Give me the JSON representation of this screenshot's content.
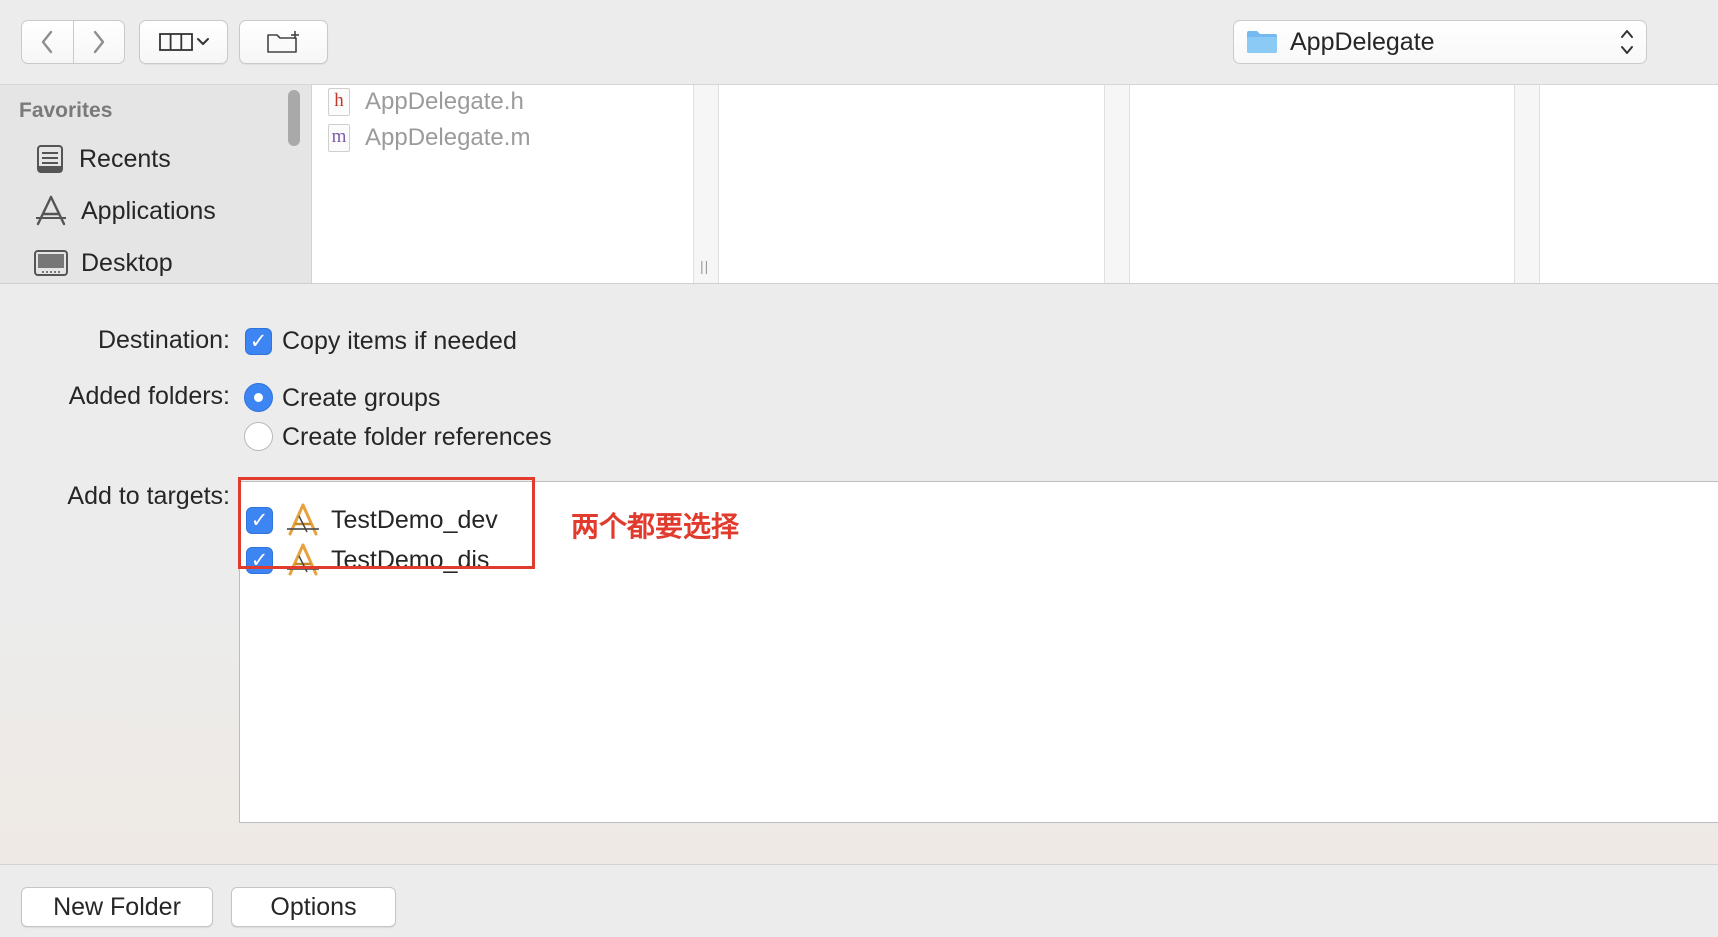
{
  "toolbar": {
    "location": "AppDelegate"
  },
  "sidebar": {
    "section_title": "Favorites",
    "items": [
      {
        "label": "Recents",
        "icon": "recents-icon"
      },
      {
        "label": "Applications",
        "icon": "applications-icon"
      },
      {
        "label": "Desktop",
        "icon": "desktop-icon"
      }
    ]
  },
  "browser": {
    "files": [
      {
        "name": "AppDelegate.h",
        "badge": "h"
      },
      {
        "name": "AppDelegate.m",
        "badge": "m"
      }
    ]
  },
  "options": {
    "destination_label": "Destination:",
    "destination_option": "Copy items if needed",
    "folders_label": "Added folders:",
    "folders_option_groups": "Create groups",
    "folders_option_refs": "Create folder references",
    "targets_label": "Add to targets:",
    "targets": [
      {
        "name": "TestDemo_dev",
        "checked": true
      },
      {
        "name": "TestDemo_dis",
        "checked": true
      }
    ]
  },
  "annotation": {
    "text": "两个都要选择",
    "color": "#e13b2e"
  },
  "footer": {
    "new_folder": "New Folder",
    "options": "Options"
  },
  "colors": {
    "accent": "#3d85f2",
    "folder": "#74b9f0"
  }
}
